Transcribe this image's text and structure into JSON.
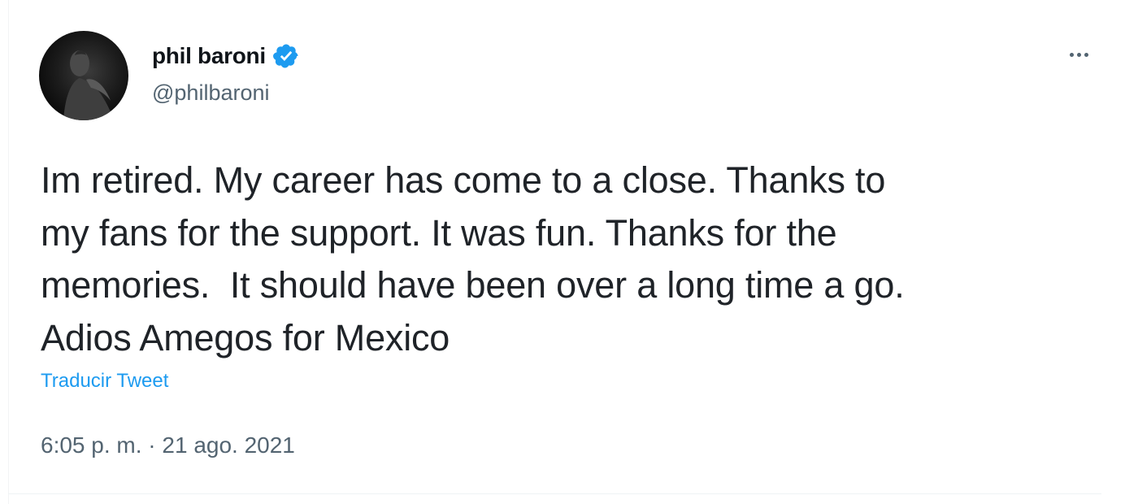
{
  "author": {
    "display_name": "phil baroni",
    "handle": "@philbaroni",
    "verified": true,
    "avatar_icon": "profile-photo"
  },
  "tweet": {
    "lines": [
      "Im retired. My career has come to a close. Thanks to",
      "my fans for the support. It was fun. Thanks for the",
      "memories.  It should have been over a long time a go.",
      "Adios Amegos for Mexico"
    ],
    "translate_label": "Traducir Tweet",
    "timestamp": "6:05 p. m. · 21 ago. 2021"
  },
  "menu": {
    "more_icon": "more-horizontal-icon"
  },
  "colors": {
    "verified_blue": "#1d9bf0",
    "link_blue": "#1d9bf0",
    "secondary_text": "#536471",
    "primary_text": "#0f1419"
  }
}
